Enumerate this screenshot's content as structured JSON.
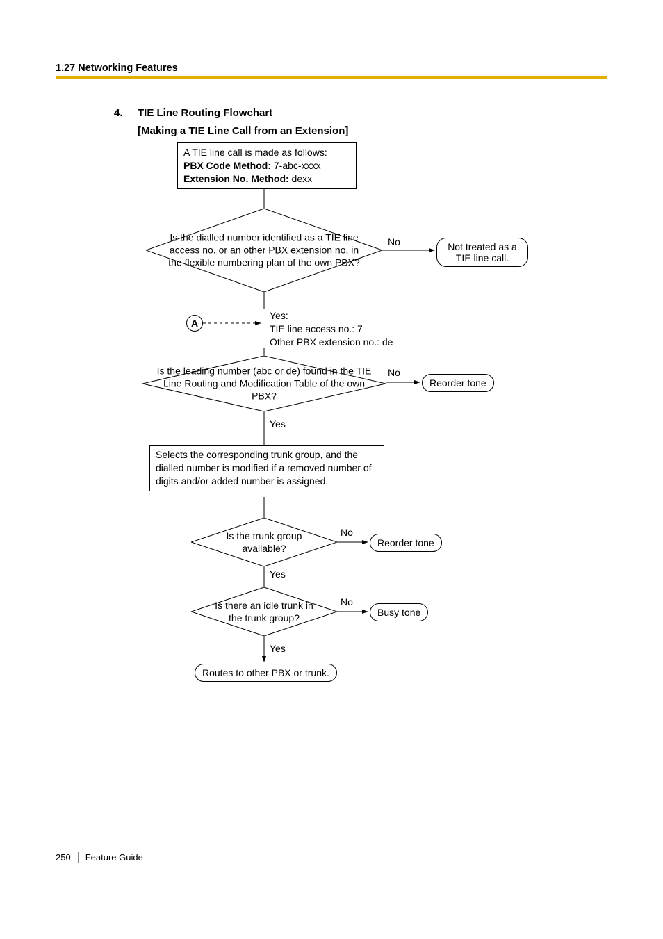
{
  "header": "1.27 Networking Features",
  "item_number": "4.",
  "title_line1": "TIE Line Routing Flowchart",
  "title_line2": "[Making a TIE Line Call from an Extension]",
  "footer": {
    "page": "250",
    "doc": "Feature Guide"
  },
  "flowchart": {
    "start": {
      "line1": "A TIE line call is made as follows:",
      "line2a": "PBX Code Method:",
      "line2b": " 7-abc-xxxx",
      "line3a": "Extension No. Method:",
      "line3b": " dexx"
    },
    "d1": {
      "text": "Is the dialled number identified as a TIE line access no. or an other PBX extension no. in the flexible numbering plan of the own PBX?",
      "yes": "Yes:",
      "yes_detail1": "TIE line access no.: 7",
      "yes_detail2": "Other PBX extension no.: de",
      "no": "No",
      "no_result": "Not treated as a TIE line call."
    },
    "connector_a": "A",
    "d2": {
      "text": "Is the leading number (abc or de) found in the TIE Line Routing and Modification Table of the own PBX?",
      "yes": "Yes",
      "no": "No",
      "no_result": "Reorder tone"
    },
    "process": "Selects the corresponding trunk group, and the dialled number is modified if a removed number of digits and/or added number is assigned.",
    "d3": {
      "text": "Is the trunk group available?",
      "yes": "Yes",
      "no": "No",
      "no_result": "Reorder tone"
    },
    "d4": {
      "text": "Is there an idle trunk in the trunk group?",
      "yes": "Yes",
      "no": "No",
      "no_result": "Busy tone"
    },
    "end": "Routes to other PBX or trunk."
  }
}
